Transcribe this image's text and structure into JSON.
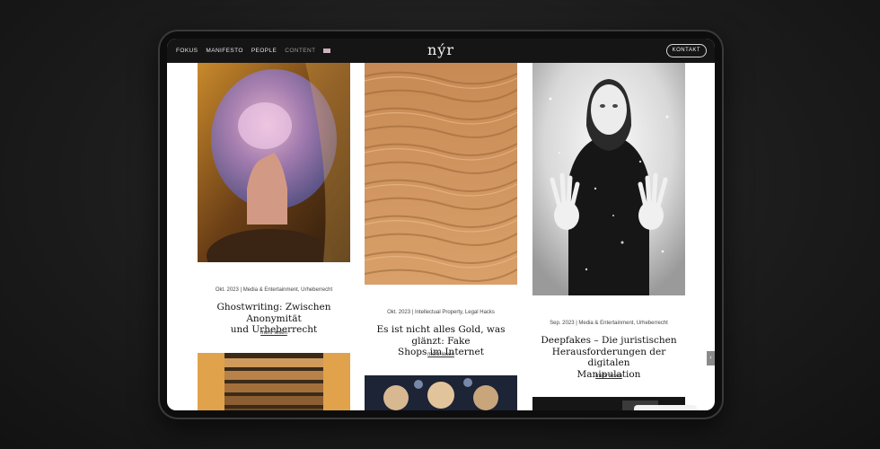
{
  "nav": {
    "links": [
      "FOKUS",
      "MANIFESTO",
      "PEOPLE",
      "CONTENT"
    ],
    "logo": "nýr",
    "contact_label": "KONTAKT",
    "language_icon": "flag-icon"
  },
  "posts": [
    {
      "meta": "Okt. 2023 | Media & Entertainment, Urheberrecht",
      "title_lines": [
        "Ghostwriting: Zwischen Anonymität",
        "und Urheberrecht"
      ],
      "more": "mehr lesen"
    },
    {
      "meta": "Okt. 2023 | Intellectual Property, Legal Hacks",
      "title_lines": [
        "Es ist nicht alles Gold, was glänzt: Fake",
        "Shops im Internet"
      ],
      "more": "mehr lesen"
    },
    {
      "meta": "Sep. 2023 | Media & Entertainment, Urheberrecht",
      "title_lines": [
        "Deepfakes – Die juristischen",
        "Herausforderungen der digitalen",
        "Manipulation"
      ],
      "more": "mehr lesen"
    }
  ],
  "scroll_icon": "chevron-left-icon"
}
